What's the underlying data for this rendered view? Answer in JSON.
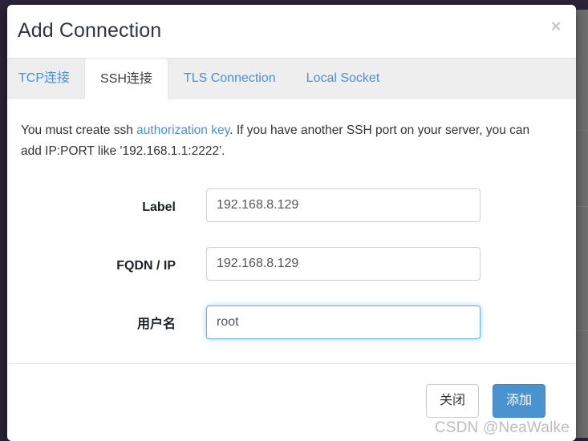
{
  "window": {
    "accent_color": "#4a93cf",
    "link_color": "#4a90d9"
  },
  "header": {
    "title": "Add Connection",
    "close_icon": "×"
  },
  "tabs": [
    {
      "label": "TCP连接",
      "active": false
    },
    {
      "label": "SSH连接",
      "active": true
    },
    {
      "label": "TLS Connection",
      "active": false
    },
    {
      "label": "Local Socket",
      "active": false
    }
  ],
  "body": {
    "hint_part1": "You must create ssh ",
    "hint_link": "authorization key",
    "hint_part2": ". If you have another SSH port on your server, you can add IP:PORT like '192.168.1.1:2222'."
  },
  "form": {
    "fields": [
      {
        "label": "Label",
        "value": "192.168.8.129",
        "placeholder": "",
        "focused": false
      },
      {
        "label": "FQDN / IP",
        "value": "192.168.8.129",
        "placeholder": "",
        "focused": false
      },
      {
        "label": "用户名",
        "value": "root",
        "placeholder": "",
        "focused": true
      }
    ]
  },
  "footer": {
    "close_label": "关闭",
    "add_label": "添加"
  },
  "watermark": {
    "text": "CSDN @NeaWalke"
  }
}
